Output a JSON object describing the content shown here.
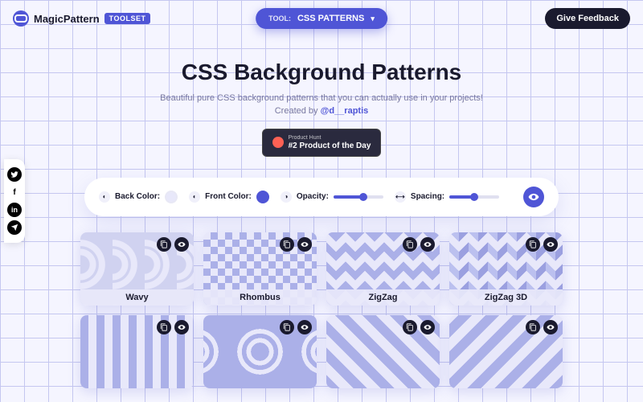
{
  "header": {
    "logo_text": "MagicPattern",
    "toolset_label": "TOOLSET",
    "tool_label": "TOOL:",
    "tool_name": "CSS PATTERNS",
    "feedback_label": "Give Feedback"
  },
  "hero": {
    "title": "CSS Background Patterns",
    "subtitle": "Beautiful pure CSS background patterns that you can actually use in your projects!",
    "credit_prefix": "Created by ",
    "credit_handle": "@d__raptis"
  },
  "product_hunt": {
    "label": "Product Hunt",
    "title": "#2 Product of the Day"
  },
  "social": {
    "icons": [
      "twitter",
      "facebook",
      "linkedin",
      "telegram"
    ]
  },
  "controls": {
    "back_color": {
      "label": "Back Color:",
      "value": "#e8e8fa"
    },
    "front_color": {
      "label": "Front Color:",
      "value": "#4f55d6"
    },
    "opacity": {
      "label": "Opacity:",
      "value": 55
    },
    "spacing": {
      "label": "Spacing:",
      "value": 45
    }
  },
  "patterns": [
    {
      "name": "Wavy",
      "cls": "pat-wavy"
    },
    {
      "name": "Rhombus",
      "cls": "pat-rhombus"
    },
    {
      "name": "ZigZag",
      "cls": "pat-zigzag"
    },
    {
      "name": "ZigZag 3D",
      "cls": "pat-zigzag3d"
    },
    {
      "name": "",
      "cls": "pat-r2-1"
    },
    {
      "name": "",
      "cls": "pat-r2-2"
    },
    {
      "name": "",
      "cls": "pat-r2-3"
    },
    {
      "name": "",
      "cls": "pat-r2-4"
    }
  ]
}
